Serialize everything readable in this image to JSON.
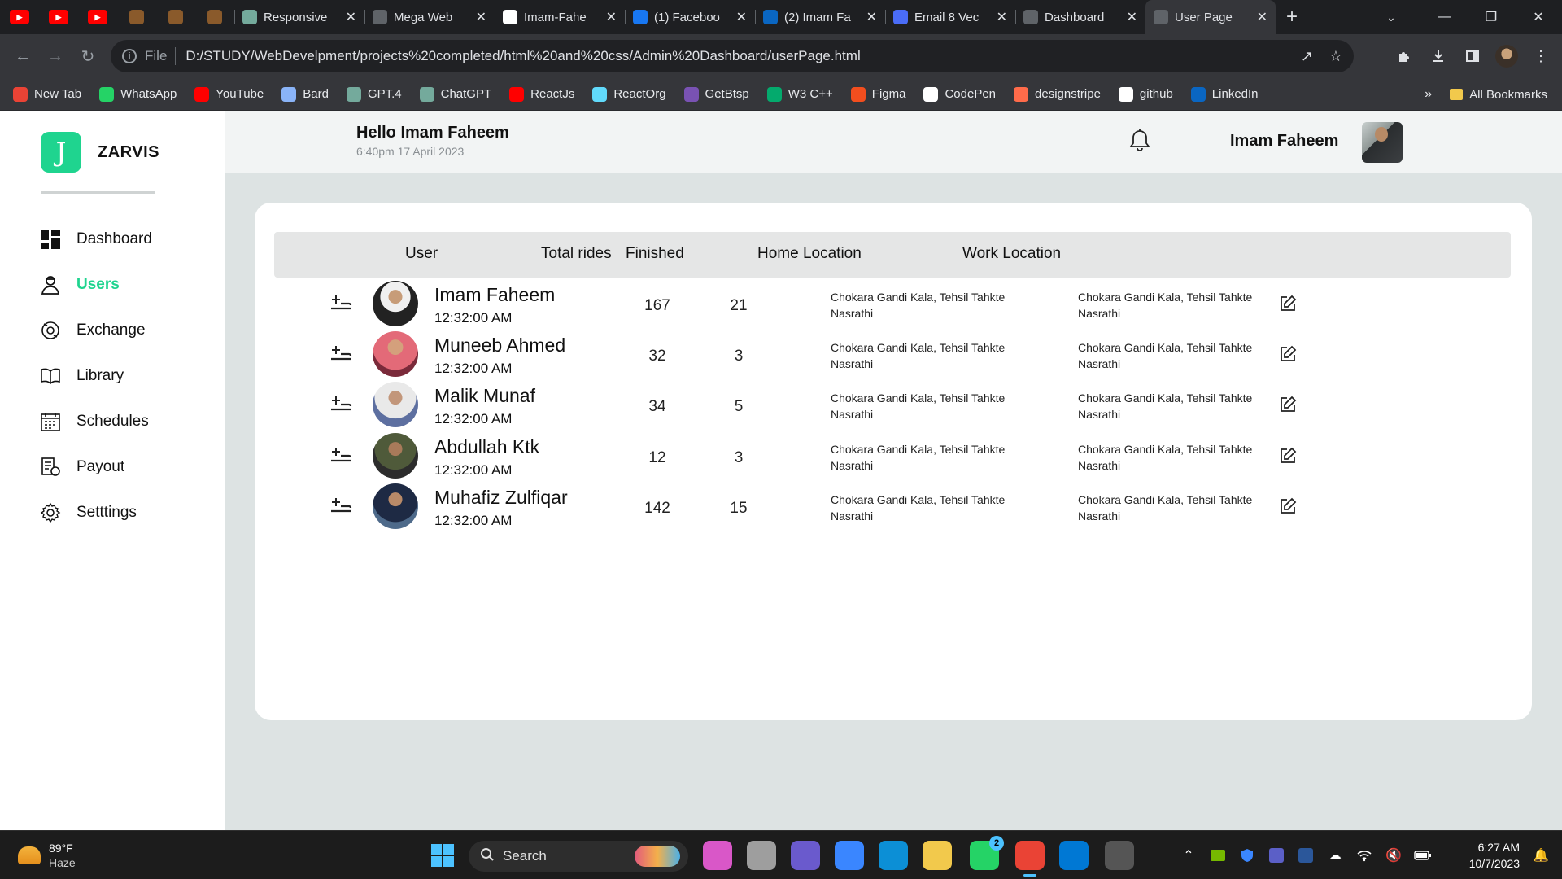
{
  "browser": {
    "tabs": [
      {
        "type": "pinned",
        "icon": "youtube-icon",
        "color": "#ff0000"
      },
      {
        "type": "pinned",
        "icon": "youtube-icon",
        "color": "#ff0000"
      },
      {
        "type": "pinned",
        "icon": "youtube-icon",
        "color": "#ff0000"
      },
      {
        "type": "pinned",
        "icon": "blogger-icon",
        "color": "#8a5a2b"
      },
      {
        "type": "pinned",
        "icon": "blogger-icon",
        "color": "#8a5a2b"
      },
      {
        "type": "pinned",
        "icon": "blogger-icon",
        "color": "#8a5a2b"
      },
      {
        "type": "normal",
        "title": "Responsive",
        "icon": "chatgpt-icon",
        "color": "#74aa9c"
      },
      {
        "type": "normal",
        "title": "Mega Web",
        "icon": "globe-icon",
        "color": "#5f6368"
      },
      {
        "type": "normal",
        "title": "Imam-Fahe",
        "icon": "github-icon",
        "color": "#ffffff"
      },
      {
        "type": "normal",
        "title": "(1) Faceboo",
        "icon": "facebook-icon",
        "color": "#1877f2"
      },
      {
        "type": "normal",
        "title": "(2) Imam Fa",
        "icon": "linkedin-icon",
        "color": "#0a66c2"
      },
      {
        "type": "normal",
        "title": "Email 8 Vec",
        "icon": "document-icon",
        "color": "#4a6cf7"
      },
      {
        "type": "normal",
        "title": "Dashboard",
        "icon": "globe-icon",
        "color": "#5f6368"
      },
      {
        "type": "normal",
        "title": "User Page",
        "icon": "globe-icon",
        "color": "#5f6368",
        "active": true
      }
    ],
    "omnibox": {
      "scheme": "File",
      "url": "D:/STUDY/WebDevelpment/projects%20completed/html%20and%20css/Admin%20Dashboard/userPage.html"
    },
    "bookmarks": [
      {
        "label": "New Tab",
        "icon": "chrome-icon",
        "color": "#ea4335"
      },
      {
        "label": "WhatsApp",
        "icon": "whatsapp-icon",
        "color": "#25d366"
      },
      {
        "label": "YouTube",
        "icon": "youtube-icon",
        "color": "#ff0000"
      },
      {
        "label": "Bard",
        "icon": "bard-icon",
        "color": "#8ab4f8"
      },
      {
        "label": "GPT.4",
        "icon": "chatgpt-icon",
        "color": "#74aa9c"
      },
      {
        "label": "ChatGPT",
        "icon": "chatgpt-icon",
        "color": "#74aa9c"
      },
      {
        "label": "ReactJs",
        "icon": "youtube-icon",
        "color": "#ff0000"
      },
      {
        "label": "ReactOrg",
        "icon": "react-icon",
        "color": "#61dafb"
      },
      {
        "label": "GetBtsp",
        "icon": "bootstrap-icon",
        "color": "#7952b3"
      },
      {
        "label": "W3 C++",
        "icon": "w3schools-icon",
        "color": "#04aa6d"
      },
      {
        "label": "Figma",
        "icon": "figma-icon",
        "color": "#f24e1e"
      },
      {
        "label": "CodePen",
        "icon": "codepen-icon",
        "color": "#ffffff"
      },
      {
        "label": "designstripe",
        "icon": "designstripe-icon",
        "color": "#ff6b4a"
      },
      {
        "label": "github",
        "icon": "github-icon",
        "color": "#ffffff"
      },
      {
        "label": "LinkedIn",
        "icon": "linkedin-icon",
        "color": "#0a66c2"
      }
    ],
    "bookmarks_more": "»",
    "all_bookmarks": "All Bookmarks"
  },
  "app": {
    "brand": {
      "logo_letter": "J",
      "name": "ZARVIS",
      "accent": "#1fd48f"
    },
    "menu": [
      {
        "label": "Dashboard",
        "icon": "dashboard-icon"
      },
      {
        "label": "Users",
        "icon": "users-icon",
        "active": true
      },
      {
        "label": "Exchange",
        "icon": "exchange-icon"
      },
      {
        "label": "Library",
        "icon": "library-icon"
      },
      {
        "label": "Schedules",
        "icon": "schedules-icon"
      },
      {
        "label": "Payout",
        "icon": "payout-icon"
      },
      {
        "label": "Setttings",
        "icon": "settings-icon"
      }
    ],
    "header": {
      "greeting": "Hello Imam Faheem",
      "datetime": "6:40pm 17 April 2023",
      "user_name": "Imam Faheem"
    },
    "table": {
      "columns": [
        "User",
        "Total rides",
        "Finished",
        "Home Location",
        "Work Location"
      ],
      "rows": [
        {
          "name": "Imam Faheem",
          "time": "12:32:00 AM",
          "total_rides": "167",
          "finished": "21",
          "home": "Chokara Gandi Kala, Tehsil Tahkte Nasrathi",
          "work": "Chokara Gandi Kala, Tehsil Tahkte Nasrathi"
        },
        {
          "name": "Muneeb Ahmed",
          "time": "12:32:00 AM",
          "total_rides": "32",
          "finished": "3",
          "home": "Chokara Gandi Kala, Tehsil Tahkte Nasrathi",
          "work": "Chokara Gandi Kala, Tehsil Tahkte Nasrathi"
        },
        {
          "name": "Malik Munaf",
          "time": "12:32:00 AM",
          "total_rides": "34",
          "finished": "5",
          "home": "Chokara Gandi Kala, Tehsil Tahkte Nasrathi",
          "work": "Chokara Gandi Kala, Tehsil Tahkte Nasrathi"
        },
        {
          "name": "Abdullah Ktk",
          "time": "12:32:00 AM",
          "total_rides": "12",
          "finished": "3",
          "home": "Chokara Gandi Kala, Tehsil Tahkte Nasrathi",
          "work": "Chokara Gandi Kala, Tehsil Tahkte Nasrathi"
        },
        {
          "name": "Muhafiz Zulfiqar",
          "time": "12:32:00 AM",
          "total_rides": "142",
          "finished": "15",
          "home": "Chokara Gandi Kala, Tehsil Tahkte Nasrathi",
          "work": "Chokara Gandi Kala, Tehsil Tahkte Nasrathi"
        }
      ]
    }
  },
  "taskbar": {
    "weather": {
      "temp": "89°F",
      "condition": "Haze"
    },
    "search_label": "Search",
    "apps": [
      {
        "name": "copilot-icon",
        "color": "#d957c8"
      },
      {
        "name": "file-manager-icon",
        "color": "#9e9e9e"
      },
      {
        "name": "meet-icon",
        "color": "#6a5acd"
      },
      {
        "name": "store-icon",
        "color": "#3a86ff"
      },
      {
        "name": "edge-icon",
        "color": "#0c8fd6"
      },
      {
        "name": "file-explorer-icon",
        "color": "#f2c94c"
      },
      {
        "name": "whatsapp-icon",
        "color": "#25d366",
        "badge": "2"
      },
      {
        "name": "chrome-icon",
        "color": "#ea4335",
        "active": true
      },
      {
        "name": "vscode-icon",
        "color": "#0078d4"
      },
      {
        "name": "clapper-icon",
        "color": "#555555"
      }
    ],
    "time": "6:27 AM",
    "date": "10/7/2023"
  }
}
